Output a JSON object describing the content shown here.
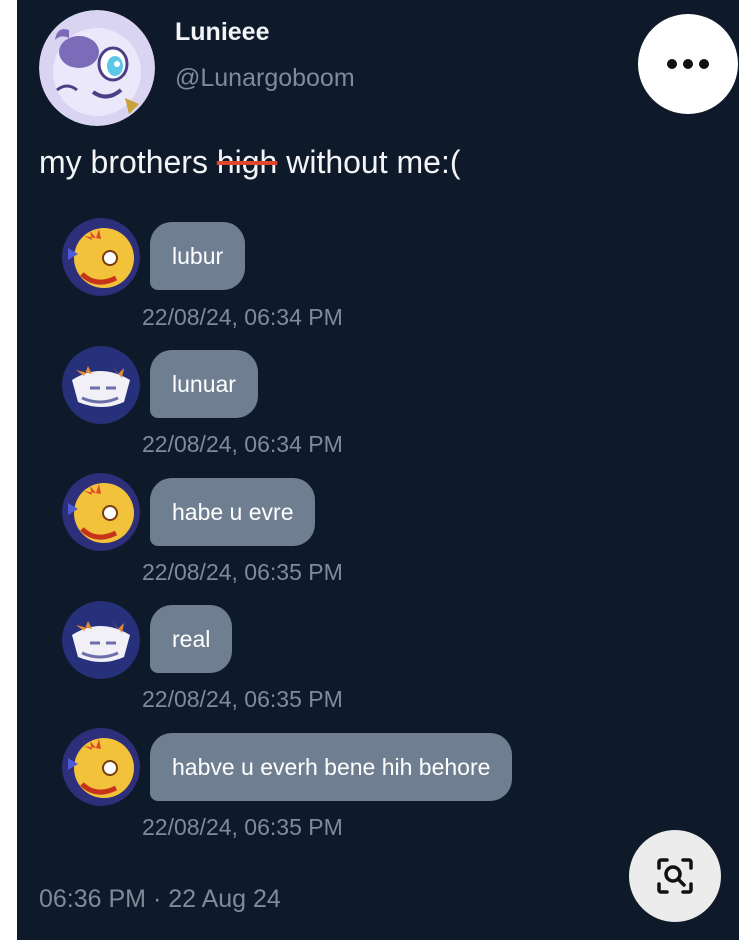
{
  "post": {
    "display_name": "Lunieee",
    "handle": "@Lunargoboom",
    "text_before": "my brothers ",
    "text_struck": "high",
    "text_after": " without me:(",
    "footer_meta": "06:36 PM · 22 Aug 24"
  },
  "icons": {
    "more": "more-horizontal-icon",
    "lens": "visual-search-icon"
  },
  "colors": {
    "background": "#0e1a2a",
    "bubble": "#6f7f91",
    "strike": "#e0462a",
    "muted_text": "#7e8b99"
  },
  "chat": {
    "messages": [
      {
        "sender": "yellow",
        "text": "lubur",
        "time": "22/08/24, 06:34 PM"
      },
      {
        "sender": "blue",
        "text": "lunuar",
        "time": "22/08/24, 06:34 PM"
      },
      {
        "sender": "yellow",
        "text": "habe u evre",
        "time": "22/08/24, 06:35 PM"
      },
      {
        "sender": "blue",
        "text": "real",
        "time": "22/08/24, 06:35 PM"
      },
      {
        "sender": "yellow",
        "text": "habve u everh bene hih behore",
        "time": "22/08/24, 06:35 PM"
      }
    ]
  }
}
